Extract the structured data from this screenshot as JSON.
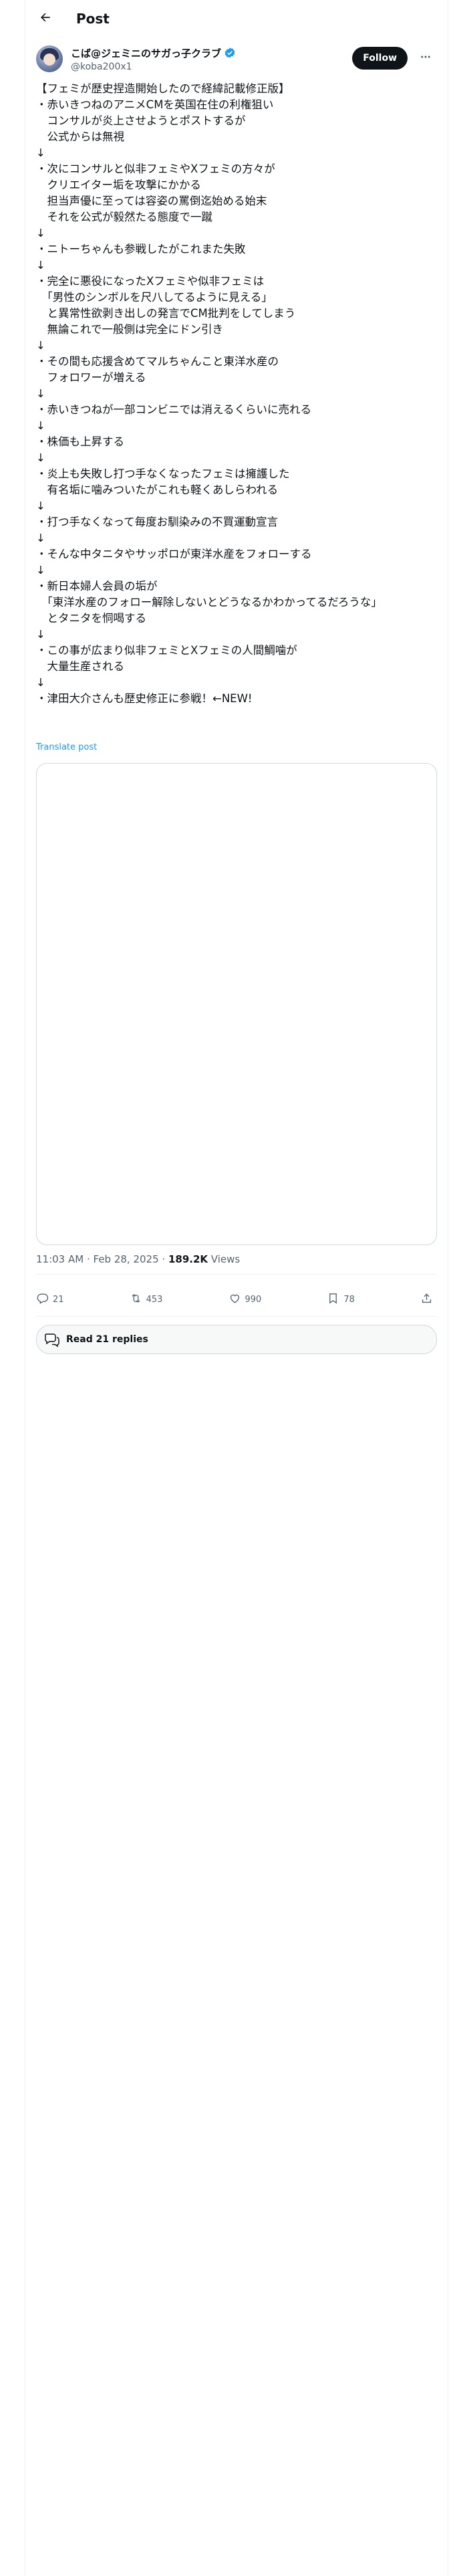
{
  "header": {
    "title": "Post"
  },
  "author": {
    "name": "こば@ジェミニのサガっ子クラブ",
    "handle": "@koba200x1",
    "follow_label": "Follow"
  },
  "tweet": {
    "lines": [
      "【フェミが歴史捏造開始したので経緯記載修正版】",
      "・赤いきつねのアニメCMを英国在住の利権狙い",
      "　コンサルが炎上させようとポストするが",
      "　公式からは無視",
      "↓",
      "・次にコンサルと似非フェミやXフェミの方々が",
      "　クリエイター垢を攻撃にかかる",
      "　担当声優に至っては容姿の罵倒迄始める始末",
      "　それを公式が毅然たる態度で一蹴",
      "↓",
      "・ニトーちゃんも参戦したがこれまた失敗",
      "↓",
      "・完全に悪役になったXフェミや似非フェミは",
      "　「男性のシンボルを尺八してるように見える」",
      "　と異常性欲剥き出しの発言でCM批判をしてしまう",
      "　無論これで一般側は完全にドン引き",
      "↓",
      "・その間も応援含めてマルちゃんこと東洋水産の",
      "　フォロワーが増える",
      "↓",
      "・赤いきつねが一部コンビニでは消えるくらいに売れる",
      "↓",
      "・株価も上昇する",
      "↓",
      "・炎上も失敗し打つ手なくなったフェミは擁護した",
      "　有名垢に噛みついたがこれも軽くあしらわれる",
      "↓",
      "・打つ手なくなって毎度お馴染みの不買運動宣言",
      "↓",
      "・そんな中タニタやサッポロが東洋水産をフォローする",
      "↓",
      "・新日本婦人会員の垢が",
      "　「東洋水産のフォロー解除しないとどうなるかわかってるだろうな」",
      "　とタニタを恫喝する",
      "↓",
      "・この事が広まり似非フェミとXフェミの人間鯛噛が",
      "　大量生産される",
      "↓",
      "・津田大介さんも歴史修正に参戦！←NEW!"
    ],
    "translate_label": "Translate post"
  },
  "meta": {
    "time": "11:03 AM",
    "separator": " · ",
    "date": "Feb 28, 2025",
    "views_count": "189.2K",
    "views_label": " Views"
  },
  "actions": {
    "replies": "21",
    "reposts": "453",
    "likes": "990",
    "bookmarks": "78"
  },
  "read_replies_label": "Read 21 replies",
  "icons": {
    "back": "arrow-left-icon",
    "verified": "verified-badge-icon",
    "more": "more-dots-icon",
    "reply": "reply-icon",
    "repost": "repost-icon",
    "like": "heart-icon",
    "bookmark": "bookmark-icon",
    "share": "share-icon",
    "read_replies": "chat-bubbles-icon"
  },
  "colors": {
    "accent": "#1d9bf0",
    "text": "#0f1419",
    "muted": "#536471",
    "follow_bg": "#0f1419",
    "border": "#cfd9de"
  }
}
